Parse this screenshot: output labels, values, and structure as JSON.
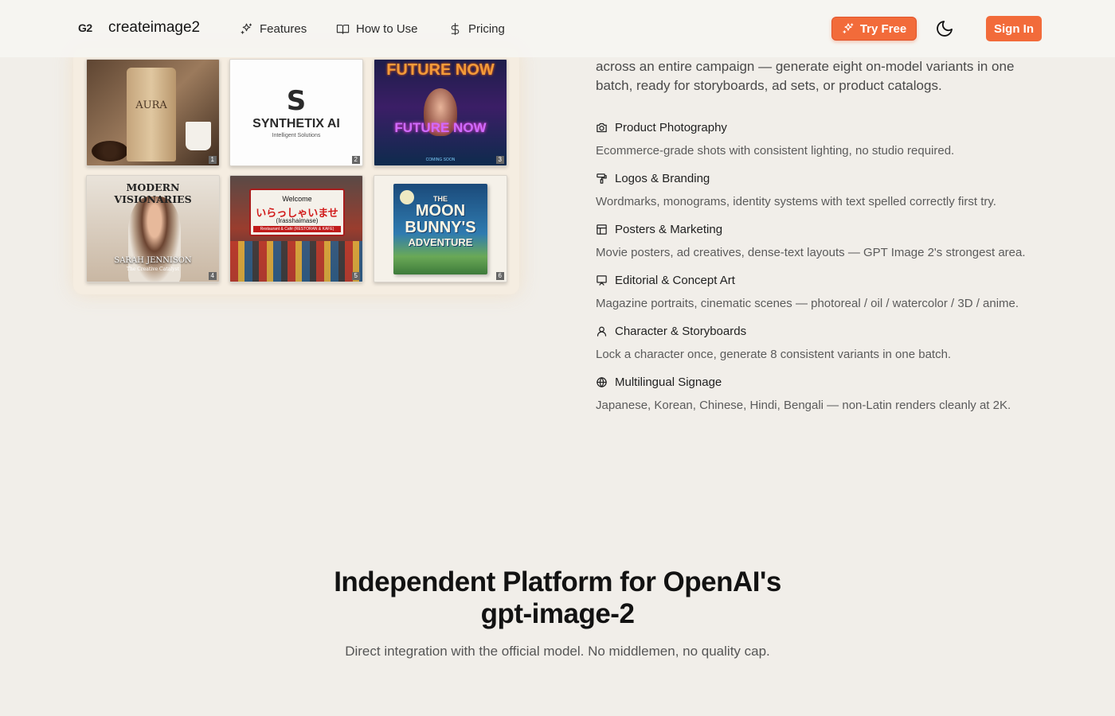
{
  "header": {
    "logo_mark": "G2",
    "brand": "createimage2",
    "nav": [
      {
        "label": "Features",
        "icon": "sparkles-icon"
      },
      {
        "label": "How to Use",
        "icon": "book-open-icon"
      },
      {
        "label": "Pricing",
        "icon": "dollar-icon"
      }
    ],
    "try_free": "Try Free",
    "sign_in": "Sign In",
    "theme_icon": "moon-icon",
    "accent_color": "#f26b3a"
  },
  "intro": {
    "text": "across an entire campaign — generate eight on-model variants in one batch, ready for storyboards, ad sets, or product catalogs."
  },
  "gallery": {
    "tiles": [
      {
        "number": "1",
        "label": "AURA"
      },
      {
        "number": "2",
        "label": "SYNTHETIX AI",
        "sublabel": "Intelligent Solutions"
      },
      {
        "number": "3",
        "label": "FUTURE NOW",
        "sublabel": "COMING SOON"
      },
      {
        "number": "4",
        "label": "MODERN VISIONARIES",
        "name": "SARAH JENNISON",
        "sublabel": "The Creative Catalyst"
      },
      {
        "number": "5",
        "line1": "Welcome",
        "line2": "いらっしゃいませ",
        "line3": "(Irasshaimase)",
        "line4": "Restaurant & Café (RESTORAN & KAFE)"
      },
      {
        "number": "6",
        "the": "THE",
        "line1": "MOON",
        "line2": "BUNNY'S",
        "line3": "ADVENTURE"
      }
    ]
  },
  "features": [
    {
      "title": "Product Photography",
      "desc": "Ecommerce-grade shots with consistent lighting, no studio required.",
      "icon": "camera-icon"
    },
    {
      "title": "Logos & Branding",
      "desc": "Wordmarks, monograms, identity systems with text spelled correctly first try.",
      "icon": "paint-roller-icon"
    },
    {
      "title": "Posters & Marketing",
      "desc": "Movie posters, ad creatives, dense-text layouts — GPT Image 2's strongest area.",
      "icon": "layout-icon"
    },
    {
      "title": "Editorial & Concept Art",
      "desc": "Magazine portraits, cinematic scenes — photoreal / oil / watercolor / 3D / anime.",
      "icon": "easel-icon"
    },
    {
      "title": "Character & Storyboards",
      "desc": "Lock a character once, generate 8 consistent variants in one batch.",
      "icon": "user-icon"
    },
    {
      "title": "Multilingual Signage",
      "desc": "Japanese, Korean, Chinese, Hindi, Bengali — non-Latin renders cleanly at 2K.",
      "icon": "globe-icon"
    }
  ],
  "platform": {
    "title_line1": "Independent Platform for OpenAI's",
    "title_line2": "gpt-image-2",
    "subtitle": "Direct integration with the official model. No middlemen, no quality cap."
  }
}
